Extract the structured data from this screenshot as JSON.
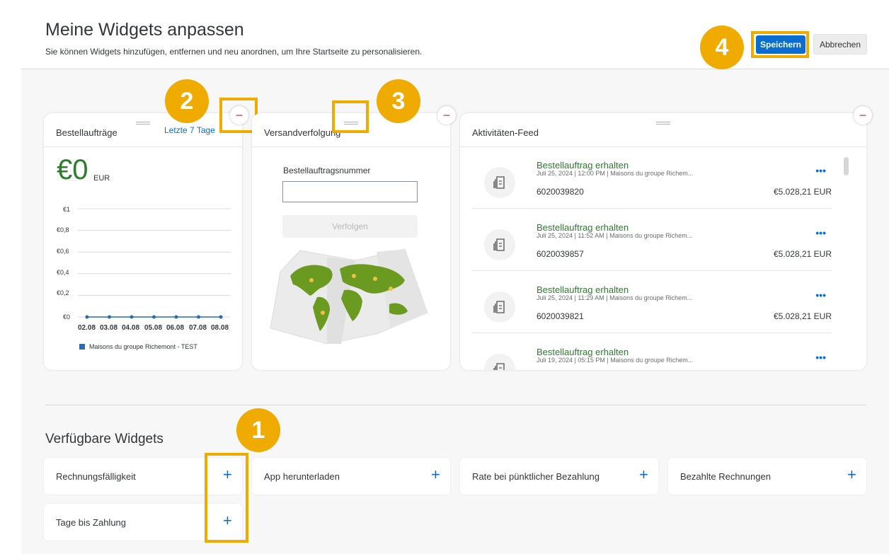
{
  "header": {
    "title": "Meine Widgets anpassen",
    "subtitle": "Sie können Widgets hinzufügen, entfernen und neu anordnen, um Ihre Startseite zu personalisieren.",
    "save_label": "Speichern",
    "cancel_label": "Abbrechen"
  },
  "callouts": {
    "one": "1",
    "two": "2",
    "three": "3",
    "four": "4"
  },
  "widgets": {
    "orders": {
      "title": "Bestellaufträge",
      "range_link": "Letzte 7 Tage",
      "kpi_value": "€0",
      "kpi_unit": "EUR",
      "legend": "Maisons du groupe Richemont - TEST"
    },
    "tracking": {
      "title": "Versandverfolgung",
      "field_label": "Bestellauftragsnummer",
      "input_value": "",
      "track_button": "Verfolgen"
    },
    "feed": {
      "title": "Aktivitäten-Feed",
      "items": [
        {
          "title": "Bestellauftrag erhalten",
          "meta": "Juli 25, 2024  |  12:00 PM  |  Maisons du groupe Richem...",
          "id": "6020039820",
          "amount": "€5.028,21 EUR"
        },
        {
          "title": "Bestellauftrag erhalten",
          "meta": "Juli 25, 2024  |  11:52 AM  |  Maisons du groupe Richem...",
          "id": "6020039857",
          "amount": "€5.028,21 EUR"
        },
        {
          "title": "Bestellauftrag erhalten",
          "meta": "Juli 25, 2024  |  11:29 AM  |  Maisons du groupe Richem...",
          "id": "6020039821",
          "amount": "€5.028,21 EUR"
        },
        {
          "title": "Bestellauftrag erhalten",
          "meta": "Juli 19, 2024  |  05:15 PM  |  Maisons du groupe Richem...",
          "id": "",
          "amount": ""
        }
      ],
      "more_glyph": "•••"
    }
  },
  "available": {
    "title": "Verfügbare Widgets",
    "tiles": [
      {
        "label": "Rechnungsfälligkeit"
      },
      {
        "label": "App herunterladen"
      },
      {
        "label": "Rate bei pünktlicher Bezahlung"
      },
      {
        "label": "Bezahlte Rechnungen"
      },
      {
        "label": "Tage bis Zahlung"
      }
    ],
    "add_glyph": "+"
  },
  "remove_glyph": "−",
  "chart_data": {
    "type": "line",
    "title": "",
    "xlabel": "",
    "ylabel": "",
    "categories": [
      "02.08",
      "03.08",
      "04.08",
      "05.08",
      "06.08",
      "07.08",
      "08.08"
    ],
    "y_ticks": [
      "€1",
      "€0,8",
      "€0,6",
      "€0,4",
      "€0,2",
      "€0"
    ],
    "ylim": [
      0,
      1
    ],
    "series": [
      {
        "name": "Maisons du groupe Richemont - TEST",
        "color": "#2a6ab3",
        "values": [
          0,
          0,
          0,
          0,
          0,
          0,
          0
        ]
      }
    ],
    "legend": "bottom-left",
    "grid": true
  },
  "colors": {
    "accent": "#0a6ed1",
    "highlight": "#f0ab00",
    "positive": "#2b7d2b",
    "remove": "#d9363e"
  }
}
